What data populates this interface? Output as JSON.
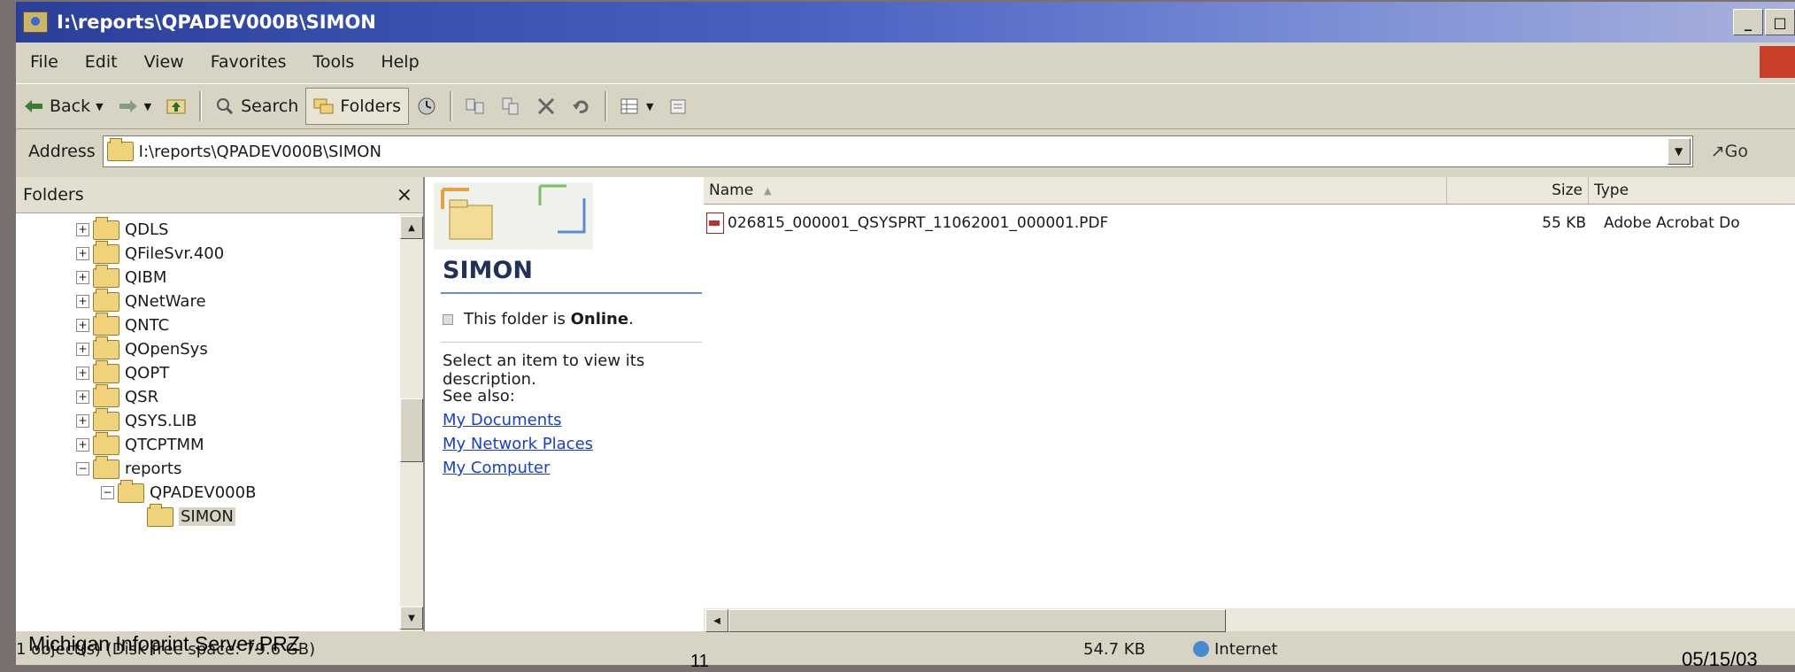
{
  "window": {
    "title": "I:\\reports\\QPADEV000B\\SIMON",
    "controls": [
      "_",
      "□"
    ]
  },
  "menu": [
    "File",
    "Edit",
    "View",
    "Favorites",
    "Tools",
    "Help"
  ],
  "toolbar": {
    "back": "Back",
    "search": "Search",
    "folders": "Folders"
  },
  "address": {
    "label": "Address",
    "value": "I:\\reports\\QPADEV000B\\SIMON",
    "go": "Go"
  },
  "folders_pane": {
    "title": "Folders",
    "close": "×",
    "items": [
      {
        "label": "QDLS",
        "expander": "+"
      },
      {
        "label": "QFileSvr.400",
        "expander": "+"
      },
      {
        "label": "QIBM",
        "expander": "+"
      },
      {
        "label": "QNetWare",
        "expander": "+"
      },
      {
        "label": "QNTC",
        "expander": "+"
      },
      {
        "label": "QOpenSys",
        "expander": "+"
      },
      {
        "label": "QOPT",
        "expander": "+"
      },
      {
        "label": "QSR",
        "expander": "+"
      },
      {
        "label": "QSYS.LIB",
        "expander": "+"
      },
      {
        "label": "QTCPTMM",
        "expander": "+"
      },
      {
        "label": "reports",
        "expander": "−"
      },
      {
        "label": "QPADEV000B",
        "expander": "−"
      },
      {
        "label": "SIMON",
        "expander": ""
      }
    ]
  },
  "task_pane": {
    "folder_name": "SIMON",
    "online_prefix": "This folder is ",
    "online_status": "Online",
    "online_suffix": ".",
    "description": "Select an item to view its description.",
    "see_also": "See also:",
    "links": [
      "My Documents",
      "My Network Places",
      "My Computer"
    ]
  },
  "file_list": {
    "columns": {
      "name": "Name",
      "size": "Size",
      "type": "Type"
    },
    "rows": [
      {
        "name": "026815_000001_QSYSPRT_11062001_000001.PDF",
        "size": "55 KB",
        "type": "Adobe Acrobat Do"
      }
    ]
  },
  "status_bar": {
    "objects": "1 object(s) (Disk free space: 79.6 GB)",
    "size": "54.7 KB",
    "zone": "Internet"
  },
  "slide": {
    "caption": "Michigan Infoprint Server.PRZ",
    "page_number": "11",
    "date": "05/15/03"
  },
  "colors": {
    "title_gradient_start": "#2a3f9a",
    "link": "#1a40c8",
    "folder_yellow": "#f0d27a"
  }
}
